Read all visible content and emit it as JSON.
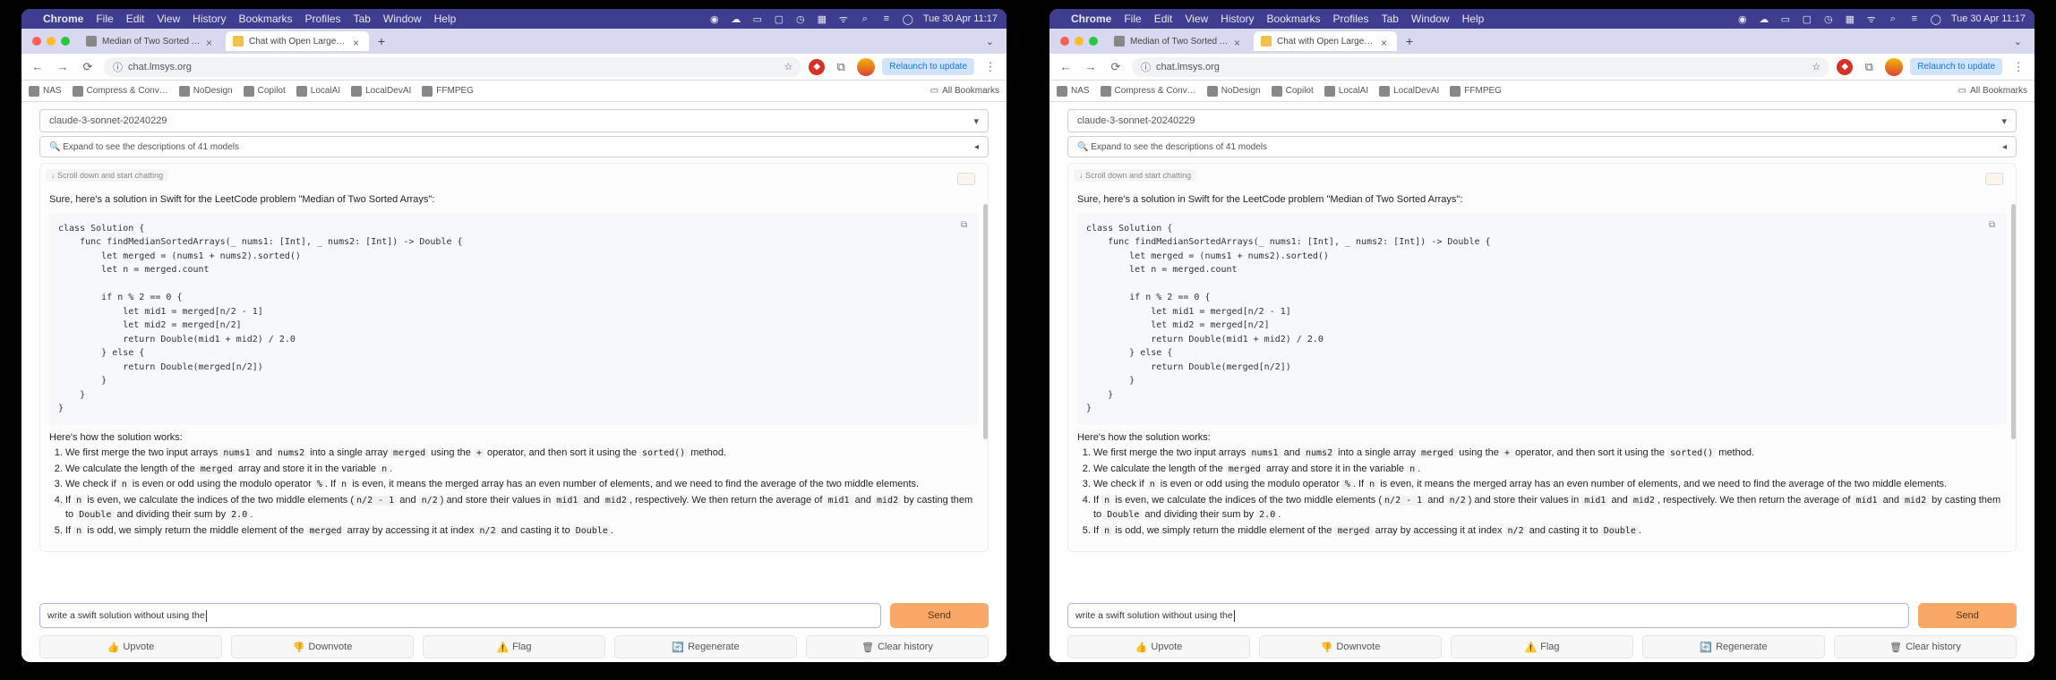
{
  "menubar": {
    "app": "Chrome",
    "items": [
      "File",
      "Edit",
      "View",
      "History",
      "Bookmarks",
      "Profiles",
      "Tab",
      "Window",
      "Help"
    ],
    "clock": "Tue 30 Apr  11:17"
  },
  "tabs": [
    {
      "title": "Median of Two Sorted Array…"
    },
    {
      "title": "Chat with Open Large Langu…"
    }
  ],
  "nav": {
    "url": "chat.lmsys.org",
    "relaunch": "Relaunch to update"
  },
  "bookmarks": [
    "NAS",
    "Compress & Conv…",
    "NoDesign",
    "Copilot",
    "LocalAI",
    "LocalDevAI",
    "FFMPEG"
  ],
  "all_bookmarks": "All Bookmarks",
  "page": {
    "model": "claude-3-sonnet-20240229",
    "expand": "Expand to see the descriptions of 41 models",
    "scroll_hint": "Scroll down and start chatting",
    "intro": "Sure, here's a solution in Swift for the LeetCode problem \"Median of Two Sorted Arrays\":",
    "code": "class Solution {\n    func findMedianSortedArrays(_ nums1: [Int], _ nums2: [Int]) -> Double {\n        let merged = (nums1 + nums2).sorted()\n        let n = merged.count\n\n        if n % 2 == 0 {\n            let mid1 = merged[n/2 - 1]\n            let mid2 = merged[n/2]\n            return Double(mid1 + mid2) / 2.0\n        } else {\n            return Double(merged[n/2])\n        }\n    }\n}",
    "how": "Here's how the solution works:",
    "steps": {
      "s1a": "We first merge the two input arrays ",
      "s1b": " and ",
      "s1c": " into a single array ",
      "s1d": " using the ",
      "s1e": " operator, and then sort it using the ",
      "s1f": " method.",
      "s2a": "We calculate the length of the ",
      "s2b": " array and store it in the variable ",
      "s2c": ".",
      "s3a": "We check if ",
      "s3b": " is even or odd using the modulo operator ",
      "s3c": ". If ",
      "s3d": " is even, it means the merged array has an even number of elements, and we need to find the average of the two middle elements.",
      "s4a": "If ",
      "s4b": " is even, we calculate the indices of the two middle elements (",
      "s4c": " and ",
      "s4d": ") and store their values in ",
      "s4e": " and ",
      "s4f": ", respectively. We then return the average of ",
      "s4g": " and ",
      "s4h": " by casting them to ",
      "s4i": " and dividing their sum by ",
      "s4j": ".",
      "s5a": "If ",
      "s5b": " is odd, we simply return the middle element of the ",
      "s5c": " array by accessing it at index ",
      "s5d": " and casting it to ",
      "s5e": "."
    },
    "tok": {
      "nums1": "nums1",
      "nums2": "nums2",
      "merged": "merged",
      "plus": "+",
      "sorted": "sorted()",
      "n": "n",
      "pct": "%",
      "nslash2m1": "n/2 - 1",
      "nslash2": "n/2",
      "mid1": "mid1",
      "mid2": "mid2",
      "double": "Double",
      "two": "2.0"
    },
    "input": "write a swift solution without using the",
    "send": "Send",
    "actions": {
      "up": "Upvote",
      "down": "Downvote",
      "flag": "Flag",
      "regen": "Regenerate",
      "clear": "Clear history"
    }
  }
}
